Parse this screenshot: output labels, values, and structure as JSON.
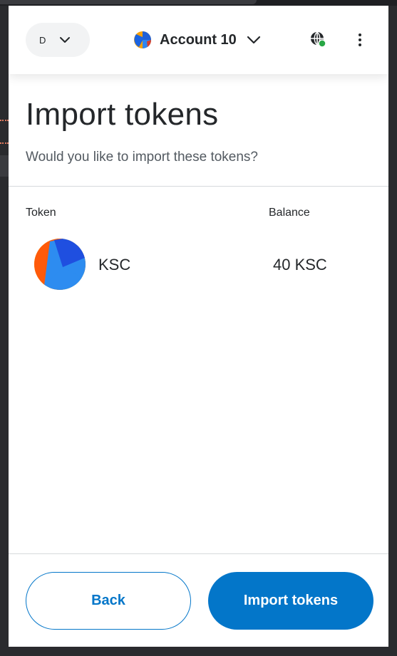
{
  "header": {
    "network_letter": "D",
    "account_name": "Account 10",
    "icons": [
      "chevron-down-icon",
      "account-avatar-icon",
      "connection-globe-icon",
      "more-menu-icon"
    ],
    "connected_dot_color": "#28a745"
  },
  "page": {
    "title": "Import tokens",
    "subtitle": "Would you like to import these tokens?"
  },
  "table": {
    "columns": [
      "Token",
      "Balance"
    ],
    "rows": [
      {
        "symbol": "KSC",
        "balance": "40 KSC"
      }
    ]
  },
  "actions": {
    "back_label": "Back",
    "import_label": "Import tokens"
  },
  "colors": {
    "primary": "#0376c9",
    "text": "#24272a",
    "muted": "#535a61"
  }
}
